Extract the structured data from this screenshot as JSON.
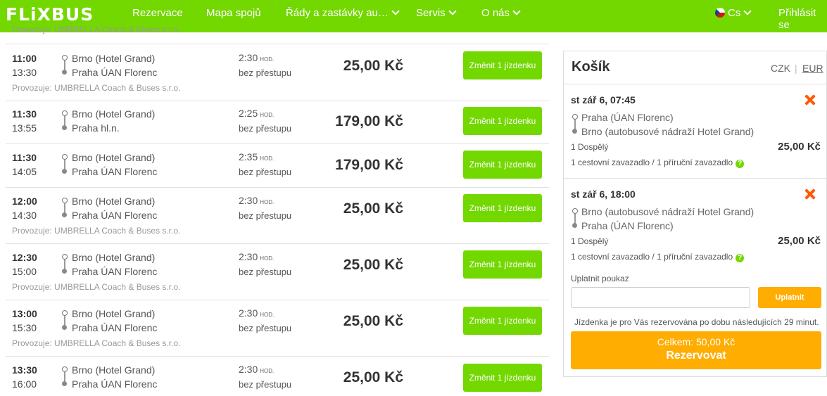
{
  "header": {
    "logo": "FLiXBUS",
    "nav": [
      "Rezervace",
      "Mapa spojů",
      "Řády a zastávky au…",
      "Servis",
      "O nás"
    ],
    "language": "Cs",
    "login": "Přihlásit se"
  },
  "results": {
    "cut_operator": "Provozuje: UMBRELLA Coach & Buses s.r.o.",
    "rows": [
      {
        "dep": "11:00",
        "arr": "13:30",
        "from": "Brno (Hotel Grand)",
        "to": "Praha ÚAN Florenc",
        "duration": "2:30",
        "dur_unit": "HOD.",
        "transfers": "bez přestupu",
        "price": "25,00 Kč",
        "button": "Změnit 1 jízdenku",
        "operator": "Provozuje: UMBRELLA Coach & Buses s.r.o."
      },
      {
        "dep": "11:30",
        "arr": "13:55",
        "from": "Brno (Hotel Grand)",
        "to": "Praha hl.n.",
        "duration": "2:25",
        "dur_unit": "HOD.",
        "transfers": "bez přestupu",
        "price": "179,00 Kč",
        "button": "Změnit 1 jízdenku",
        "operator": ""
      },
      {
        "dep": "11:30",
        "arr": "14:05",
        "from": "Brno (Hotel Grand)",
        "to": "Praha ÚAN Florenc",
        "duration": "2:35",
        "dur_unit": "HOD.",
        "transfers": "bez přestupu",
        "price": "179,00 Kč",
        "button": "Změnit 1 jízdenku",
        "operator": ""
      },
      {
        "dep": "12:00",
        "arr": "14:30",
        "from": "Brno (Hotel Grand)",
        "to": "Praha ÚAN Florenc",
        "duration": "2:30",
        "dur_unit": "HOD.",
        "transfers": "bez přestupu",
        "price": "25,00 Kč",
        "button": "Změnit 1 jízdenku",
        "operator": "Provozuje: UMBRELLA Coach & Buses s.r.o."
      },
      {
        "dep": "12:30",
        "arr": "15:00",
        "from": "Brno (Hotel Grand)",
        "to": "Praha ÚAN Florenc",
        "duration": "2:30",
        "dur_unit": "HOD.",
        "transfers": "bez přestupu",
        "price": "25,00 Kč",
        "button": "Změnit 1 jízdenku",
        "operator": "Provozuje: UMBRELLA Coach & Buses s.r.o."
      },
      {
        "dep": "13:00",
        "arr": "15:30",
        "from": "Brno (Hotel Grand)",
        "to": "Praha ÚAN Florenc",
        "duration": "2:30",
        "dur_unit": "HOD.",
        "transfers": "bez přestupu",
        "price": "25,00 Kč",
        "button": "Změnit 1 jízdenku",
        "operator": "Provozuje: UMBRELLA Coach & Buses s.r.o."
      },
      {
        "dep": "13:30",
        "arr": "16:00",
        "from": "Brno (Hotel Grand)",
        "to": "Praha ÚAN Florenc",
        "duration": "2:30",
        "dur_unit": "HOD.",
        "transfers": "bez přestupu",
        "price": "25,00 Kč",
        "button": "Změnit 1 jízdenku",
        "operator": ""
      }
    ]
  },
  "cart": {
    "title": "Košík",
    "currency_czk": "CZK",
    "currency_eur": "EUR",
    "trips": [
      {
        "date": "st zář 6, 07:45",
        "from": "Praha (ÚAN Florenc)",
        "to": "Brno (autobusové nádraží Hotel Grand)",
        "passengers": "1 Dospělý",
        "price": "25,00 Kč",
        "luggage": "1 cestovní zavazadlo / 1 příruční zavazadlo"
      },
      {
        "date": "st zář 6, 18:00",
        "from": "Brno (autobusové nádraží Hotel Grand)",
        "to": "Praha (ÚAN Florenc)",
        "passengers": "1 Dospělý",
        "price": "25,00 Kč",
        "luggage": "1 cestovní zavazadlo / 1 příruční zavazadlo"
      }
    ],
    "voucher_label": "Uplatnit poukaz",
    "voucher_value": "",
    "apply_button": "Uplatnit",
    "reservation_note": "Jízdenka je pro Vás rezervována po dobu následujících 29 minut.",
    "total": "Celkem: 50,00 Kč",
    "book_button": "Rezervovat"
  },
  "colors": {
    "brand_green": "#73d700",
    "orange": "#ffad00",
    "remove": "#ff5a00"
  }
}
